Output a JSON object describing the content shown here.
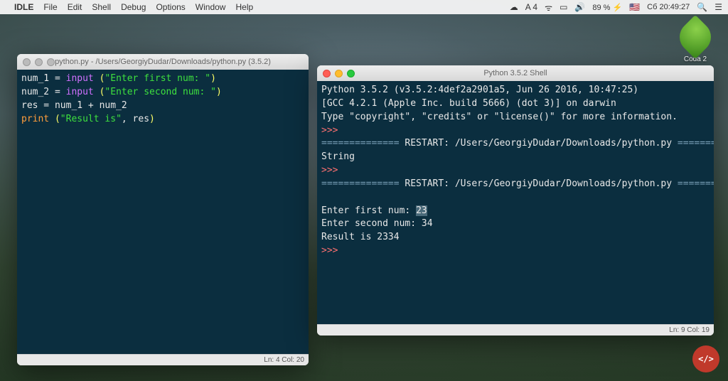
{
  "menubar": {
    "app_name": "IDLE",
    "items": [
      "File",
      "Edit",
      "Shell",
      "Debug",
      "Options",
      "Window",
      "Help"
    ],
    "right": {
      "adobe": "A 4",
      "battery": "89 %",
      "flag": "🇺🇸",
      "clock": "Сб 20:49:27"
    }
  },
  "editor": {
    "title": "python.py - /Users/GeorgiyDudar/Downloads/python.py (3.5.2)",
    "status": "Ln: 4  Col: 20",
    "code": {
      "l1_var": "num_1",
      "l1_eq": " = ",
      "l1_fn": "input",
      "l1_op": " (",
      "l1_str": "\"Enter first num: \"",
      "l1_cl": ")",
      "l2_var": "num_2",
      "l2_eq": " = ",
      "l2_fn": "input",
      "l2_op": " (",
      "l2_str": "\"Enter second num: \"",
      "l2_cl": ")",
      "l3": "res = num_1 + num_2",
      "l4_fn": "print",
      "l4_op": " (",
      "l4_str": "\"Result is\"",
      "l4_rest": ", res",
      "l4_cl": ")"
    }
  },
  "shell": {
    "title": "Python 3.5.2 Shell",
    "status": "Ln: 9  Col: 19",
    "lines": {
      "ver": "Python 3.5.2 (v3.5.2:4def2a2901a5, Jun 26 2016, 10:47:25)",
      "gcc": "[GCC 4.2.1 (Apple Inc. build 5666) (dot 3)] on darwin",
      "hint": "Type \"copyright\", \"credits\" or \"license()\" for more information.",
      "prompt": ">>> ",
      "divider": "==============",
      "restart": " RESTART: /Users/GeorgiyDudar/Downloads/python.py ",
      "string_out": "String",
      "p1": "Enter first num: ",
      "p1_val": "23",
      "p2": "Enter second num: 34",
      "result": "Result is 2334"
    }
  },
  "desktop": {
    "icon_label": "Coda 2"
  },
  "corner": {
    "badge": "</>"
  }
}
